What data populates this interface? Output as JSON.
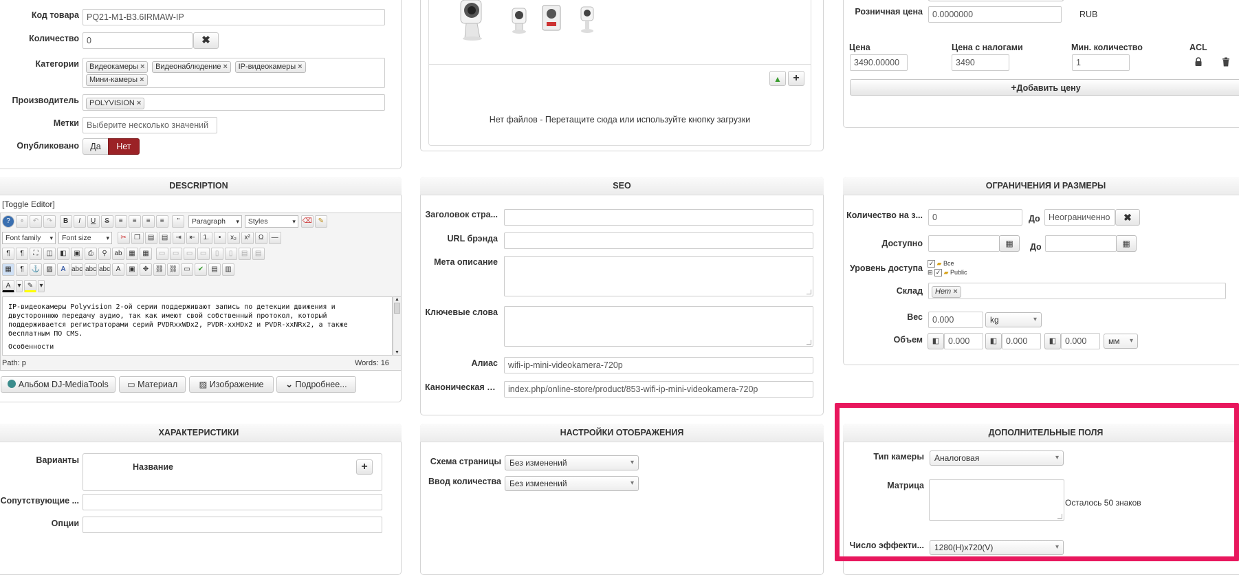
{
  "main": {
    "sku_label": "Код товара",
    "sku_value": "PQ21-M1-B3.6IRMAW-IP",
    "qty_label": "Количество",
    "qty_value": "0",
    "categories_label": "Категории",
    "categories": [
      "Видеокамеры",
      "Видеонаблюдение",
      "IP-видеокамеры",
      "Мини-камеры"
    ],
    "manufacturer_label": "Производитель",
    "manufacturer": "POLYVISION",
    "tags_label": "Метки",
    "tags_placeholder": "Выберите несколько значений",
    "published_label": "Опубликовано",
    "yes": "Да",
    "no": "Нет"
  },
  "media": {
    "no_files": "Нет файлов - Перетащите сюда или используйте кнопку загрузки"
  },
  "prices": {
    "retail_label": "Розничная цена",
    "retail_value": "0.0000000",
    "currency": "RUB",
    "col_price": "Цена",
    "col_price_tax": "Цена с налогами",
    "col_min_qty": "Мин. количество",
    "col_acl": "ACL",
    "price": "3490.00000",
    "price_tax": "3490",
    "min_qty": "1",
    "add_price": "Добавить цену"
  },
  "description": {
    "title": "DESCRIPTION",
    "toggle": "[Toggle Editor]",
    "paragraph": "Paragraph",
    "styles": "Styles",
    "font_family": "Font family",
    "font_size": "Font size",
    "text1": "IP-видеокамеры Polyvision 2-ой серии поддерживают запись по детекции движения и двустороннюю передачу аудио, так как имеют свой собственный протокол, который поддерживается регистраторами серий PVDRxxWDx2, PVDR-xxHDx2 и PVDR-xxNRx2, а также бесплатным ПО CMS.",
    "text2": "Особенности",
    "path": "Path: p",
    "words": "Words: 16",
    "btn_album": "Альбом DJ-MediaTools",
    "btn_material": "Материал",
    "btn_image": "Изображение",
    "btn_more": "Подробнее..."
  },
  "seo": {
    "title": "SEO",
    "page_title_label": "Заголовок стра...",
    "brand_url_label": "URL брэнда",
    "meta_desc_label": "Мета описание",
    "keywords_label": "Ключевые слова",
    "alias_label": "Алиас",
    "alias_value": "wifi-ip-mini-videokamera-720p",
    "canonical_label": "Каноническая с...",
    "canonical_value": "index.php/online-store/product/853-wifi-ip-mini-videokamera-720p"
  },
  "limits": {
    "title": "ОГРАНИЧЕНИЯ И РАЗМЕРЫ",
    "qty_label": "Количество на з...",
    "qty_value": "0",
    "to": "До",
    "unlimited": "Неограниченно",
    "available_label": "Доступно",
    "access_label": "Уровень доступа",
    "access_all": "Все",
    "access_public": "Public",
    "stock_label": "Склад",
    "stock_tag": "Нет",
    "weight_label": "Вес",
    "weight_value": "0.000",
    "weight_unit": "kg",
    "volume_label": "Объем",
    "dim1": "0.000",
    "dim2": "0.000",
    "dim3": "0.000",
    "dim_unit": "мм"
  },
  "characteristics": {
    "title": "ХАРАКТЕРИСТИКИ",
    "variants_label": "Варианты",
    "name_col": "Название",
    "related_label": "Сопутствующие ...",
    "options_label": "Опции"
  },
  "display": {
    "title": "НАСТРОЙКИ ОТОБРАЖЕНИЯ",
    "layout_label": "Схема страницы",
    "layout_value": "Без изменений",
    "qty_input_label": "Ввод количества",
    "qty_input_value": "Без изменений"
  },
  "extra": {
    "title": "ДОПОЛНИТЕЛЬНЫЕ ПОЛЯ",
    "camera_type_label": "Тип камеры",
    "camera_type_value": "Аналоговая",
    "matrix_label": "Матрица",
    "chars_left": "Осталось 50 знаков",
    "pixels_label": "Число эффекти...",
    "pixels_value": "1280(H)x720(V)"
  },
  "colors": {
    "no_active": "#9b2226",
    "highlight": "#e8175d"
  }
}
